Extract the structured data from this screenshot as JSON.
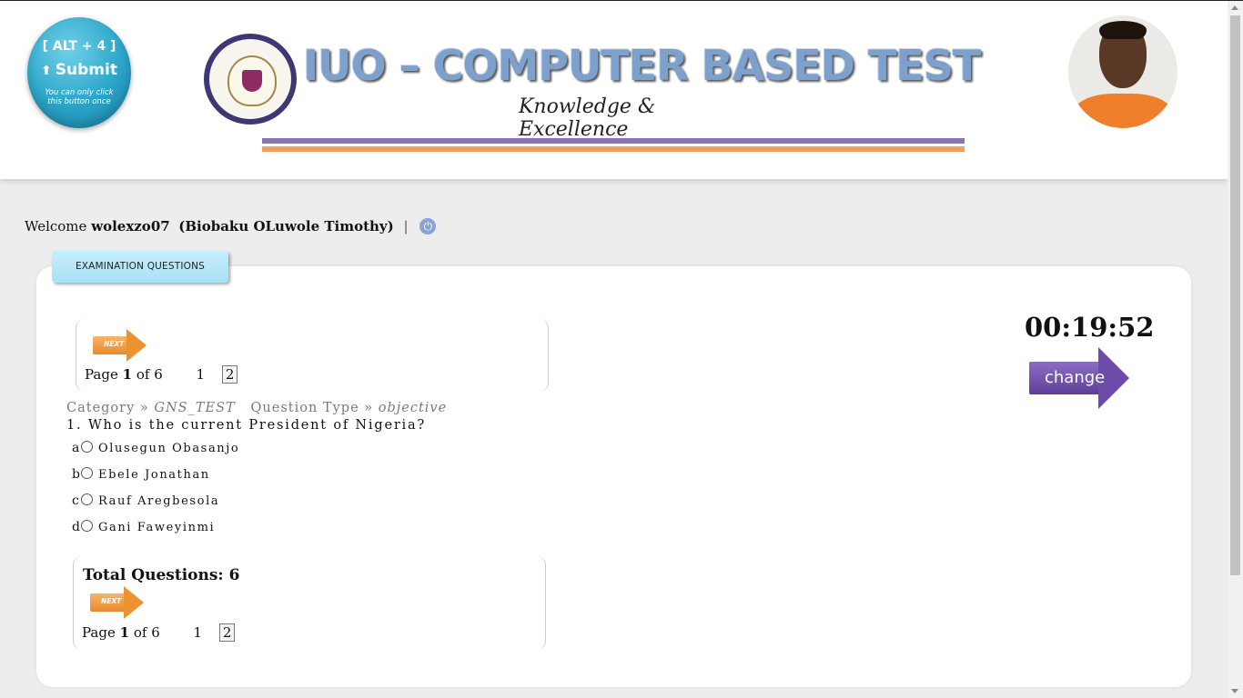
{
  "header": {
    "submit_button": {
      "shortcut": "[ ALT + 4 ]",
      "label": "Submit",
      "note": "You can only click this button once"
    },
    "banner_title": "IUO – COMPUTER BASED TEST",
    "motto": "Knowledge & Excellence"
  },
  "welcome": {
    "prefix": "Welcome",
    "username": "wolexzo07",
    "fullname": "(Biobaku OLuwole Timothy)",
    "separator": "|"
  },
  "panel": {
    "tab_label": "EXAMINATION QUESTIONS",
    "next_label": "NEXT",
    "pager": {
      "prefix": "Page",
      "current": "1",
      "of_text": "of 6",
      "links": [
        "1",
        "2"
      ]
    },
    "category_label": "Category »",
    "category_value": "GNS_TEST",
    "type_label": "Question Type »",
    "type_value": "objective",
    "question": "1. Who is the current President of Nigeria?",
    "options": [
      {
        "letter": "a",
        "text": "Olusegun Obasanjo"
      },
      {
        "letter": "b",
        "text": "Ebele Jonathan"
      },
      {
        "letter": "c",
        "text": "Rauf Aregbesola"
      },
      {
        "letter": "d",
        "text": "Gani Faweyinmi"
      }
    ],
    "total_questions": "Total Questions: 6"
  },
  "timer": {
    "value": "00:19:52",
    "change_label": "change"
  },
  "colors": {
    "submit": "#2aa4c8",
    "tab": "#b4e6f8",
    "next_arrow": "#ec922f",
    "change_arrow": "#6c4ca8",
    "bar_purple": "#8e72b8",
    "bar_orange": "#f0a05a"
  }
}
